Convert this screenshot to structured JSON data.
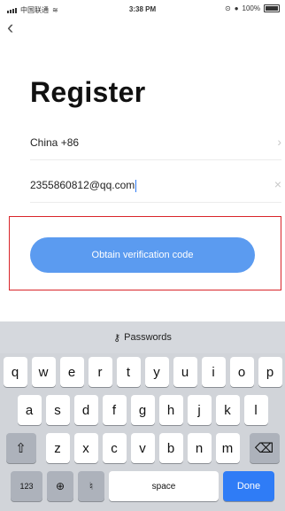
{
  "status_bar": {
    "carrier": "中国联通",
    "time": "3:38 PM",
    "battery": "100%"
  },
  "nav": {
    "back_icon": "chevron-left-icon"
  },
  "page": {
    "title": "Register"
  },
  "form": {
    "country": "China +86",
    "email_value": "2355860812@qq.com"
  },
  "actions": {
    "obtain_code_label": "Obtain verification code"
  },
  "keyboard": {
    "passwords_label": "Passwords",
    "rows": [
      [
        "q",
        "w",
        "e",
        "r",
        "t",
        "y",
        "u",
        "i",
        "o",
        "p"
      ],
      [
        "a",
        "s",
        "d",
        "f",
        "g",
        "h",
        "j",
        "k",
        "l"
      ],
      [
        "z",
        "x",
        "c",
        "v",
        "b",
        "n",
        "m"
      ]
    ],
    "numbers_key": "123",
    "space_label": "space",
    "done_label": "Done"
  },
  "colors": {
    "accent": "#5b9bf0",
    "highlight_border": "#d9252a",
    "done_key": "#2f7cf6"
  }
}
